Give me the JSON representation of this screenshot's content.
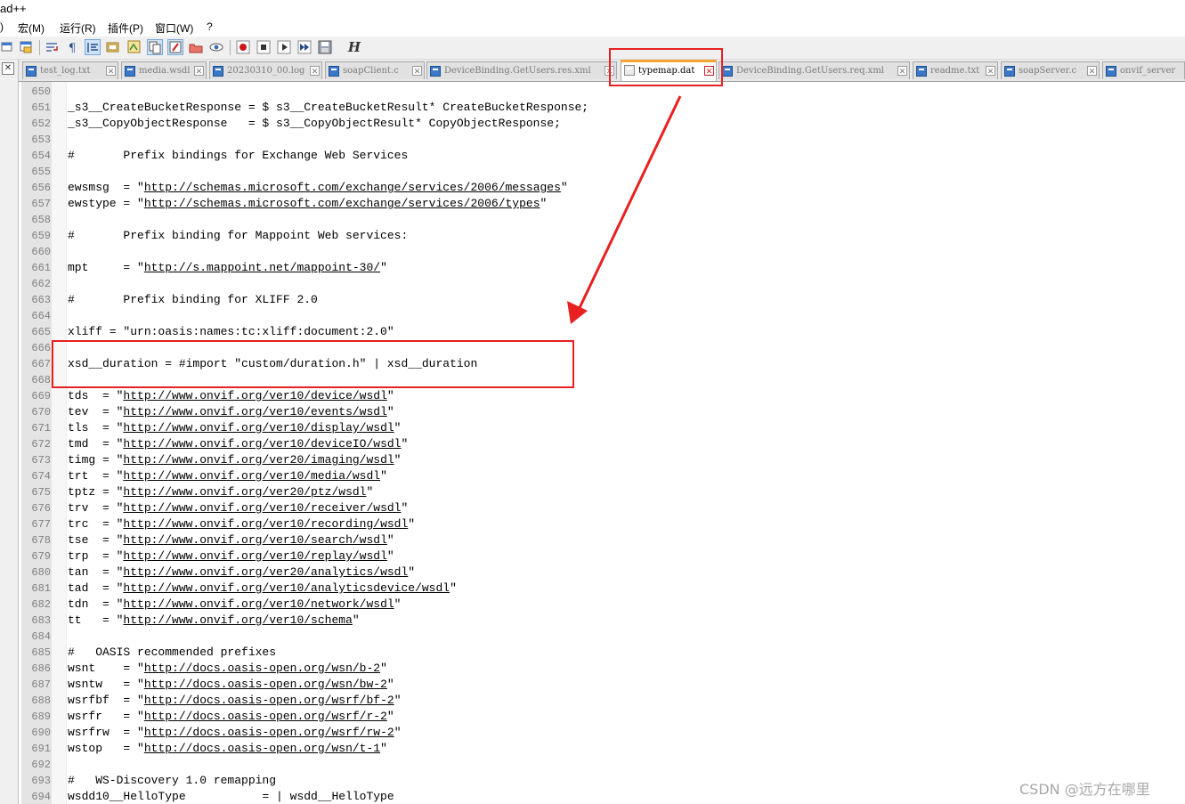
{
  "window": {
    "title_fragment": "ad++"
  },
  "menu": [
    {
      "label": ")"
    },
    {
      "label": "宏(M)"
    },
    {
      "label": "运行(R)"
    },
    {
      "label": "插件(P)"
    },
    {
      "label": "窗口(W)"
    },
    {
      "label": "?"
    }
  ],
  "toolbar": {
    "hex_label": "H"
  },
  "left_pane": {
    "close": "✕"
  },
  "tabs": [
    {
      "label": "test_log.txt"
    },
    {
      "label": "media.wsdl"
    },
    {
      "label": "20230310_00.log"
    },
    {
      "label": "soapClient.c"
    },
    {
      "label": "DeviceBinding.GetUsers.res.xml"
    },
    {
      "label": "typemap.dat",
      "active": true
    },
    {
      "label": "DeviceBinding.GetUsers.req.xml"
    },
    {
      "label": "readme.txt"
    },
    {
      "label": "soapServer.c"
    },
    {
      "label": "onvif_server"
    }
  ],
  "tab_close_glyph": "✕",
  "editor": {
    "lines": [
      {
        "n": "650",
        "text": ""
      },
      {
        "n": "651",
        "text": "_s3__CreateBucketResponse = $ s3__CreateBucketResult* CreateBucketResponse;"
      },
      {
        "n": "652",
        "text": "_s3__CopyObjectResponse   = $ s3__CopyObjectResult* CopyObjectResponse;"
      },
      {
        "n": "653",
        "text": ""
      },
      {
        "n": "654",
        "text": "#       Prefix bindings for Exchange Web Services"
      },
      {
        "n": "655",
        "text": ""
      },
      {
        "n": "656",
        "pre": "ewsmsg  = \"",
        "url": "http://schemas.microsoft.com/exchange/services/2006/messages",
        "post": "\""
      },
      {
        "n": "657",
        "pre": "ewstype = \"",
        "url": "http://schemas.microsoft.com/exchange/services/2006/types",
        "post": "\""
      },
      {
        "n": "658",
        "text": ""
      },
      {
        "n": "659",
        "text": "#       Prefix binding for Mappoint Web services:"
      },
      {
        "n": "660",
        "text": ""
      },
      {
        "n": "661",
        "pre": "mpt     = \"",
        "url": "http://s.mappoint.net/mappoint-30/",
        "post": "\""
      },
      {
        "n": "662",
        "text": ""
      },
      {
        "n": "663",
        "text": "#       Prefix binding for XLIFF 2.0"
      },
      {
        "n": "664",
        "text": ""
      },
      {
        "n": "665",
        "text": "xliff = \"urn:oasis:names:tc:xliff:document:2.0\""
      },
      {
        "n": "666",
        "text": ""
      },
      {
        "n": "667",
        "text": "xsd__duration = #import \"custom/duration.h\" | xsd__duration"
      },
      {
        "n": "668",
        "text": ""
      },
      {
        "n": "669",
        "pre": "tds  = \"",
        "url": "http://www.onvif.org/ver10/device/wsdl",
        "post": "\""
      },
      {
        "n": "670",
        "pre": "tev  = \"",
        "url": "http://www.onvif.org/ver10/events/wsdl",
        "post": "\""
      },
      {
        "n": "671",
        "pre": "tls  = \"",
        "url": "http://www.onvif.org/ver10/display/wsdl",
        "post": "\""
      },
      {
        "n": "672",
        "pre": "tmd  = \"",
        "url": "http://www.onvif.org/ver10/deviceIO/wsdl",
        "post": "\""
      },
      {
        "n": "673",
        "pre": "timg = \"",
        "url": "http://www.onvif.org/ver20/imaging/wsdl",
        "post": "\""
      },
      {
        "n": "674",
        "pre": "trt  = \"",
        "url": "http://www.onvif.org/ver10/media/wsdl",
        "post": "\""
      },
      {
        "n": "675",
        "pre": "tptz = \"",
        "url": "http://www.onvif.org/ver20/ptz/wsdl",
        "post": "\""
      },
      {
        "n": "676",
        "pre": "trv  = \"",
        "url": "http://www.onvif.org/ver10/receiver/wsdl",
        "post": "\""
      },
      {
        "n": "677",
        "pre": "trc  = \"",
        "url": "http://www.onvif.org/ver10/recording/wsdl",
        "post": "\""
      },
      {
        "n": "678",
        "pre": "tse  = \"",
        "url": "http://www.onvif.org/ver10/search/wsdl",
        "post": "\""
      },
      {
        "n": "679",
        "pre": "trp  = \"",
        "url": "http://www.onvif.org/ver10/replay/wsdl",
        "post": "\""
      },
      {
        "n": "680",
        "pre": "tan  = \"",
        "url": "http://www.onvif.org/ver20/analytics/wsdl",
        "post": "\""
      },
      {
        "n": "681",
        "pre": "tad  = \"",
        "url": "http://www.onvif.org/ver10/analyticsdevice/wsdl",
        "post": "\""
      },
      {
        "n": "682",
        "pre": "tdn  = \"",
        "url": "http://www.onvif.org/ver10/network/wsdl",
        "post": "\""
      },
      {
        "n": "683",
        "pre": "tt   = \"",
        "url": "http://www.onvif.org/ver10/schema",
        "post": "\""
      },
      {
        "n": "684",
        "text": ""
      },
      {
        "n": "685",
        "text": "#   OASIS recommended prefixes"
      },
      {
        "n": "686",
        "pre": "wsnt    = \"",
        "url": "http://docs.oasis-open.org/wsn/b-2",
        "post": "\""
      },
      {
        "n": "687",
        "pre": "wsntw   = \"",
        "url": "http://docs.oasis-open.org/wsn/bw-2",
        "post": "\""
      },
      {
        "n": "688",
        "pre": "wsrfbf  = \"",
        "url": "http://docs.oasis-open.org/wsrf/bf-2",
        "post": "\""
      },
      {
        "n": "689",
        "pre": "wsrfr   = \"",
        "url": "http://docs.oasis-open.org/wsrf/r-2",
        "post": "\""
      },
      {
        "n": "690",
        "pre": "wsrfrw  = \"",
        "url": "http://docs.oasis-open.org/wsrf/rw-2",
        "post": "\""
      },
      {
        "n": "691",
        "pre": "wstop   = \"",
        "url": "http://docs.oasis-open.org/wsn/t-1",
        "post": "\""
      },
      {
        "n": "692",
        "text": ""
      },
      {
        "n": "693",
        "text": "#   WS-Discovery 1.0 remapping"
      },
      {
        "n": "694",
        "text": "wsdd10__HelloType           = | wsdd__HelloType"
      }
    ]
  },
  "annotations": {
    "highlight_color": "#e82020"
  },
  "watermark": "CSDN @远方在哪里"
}
